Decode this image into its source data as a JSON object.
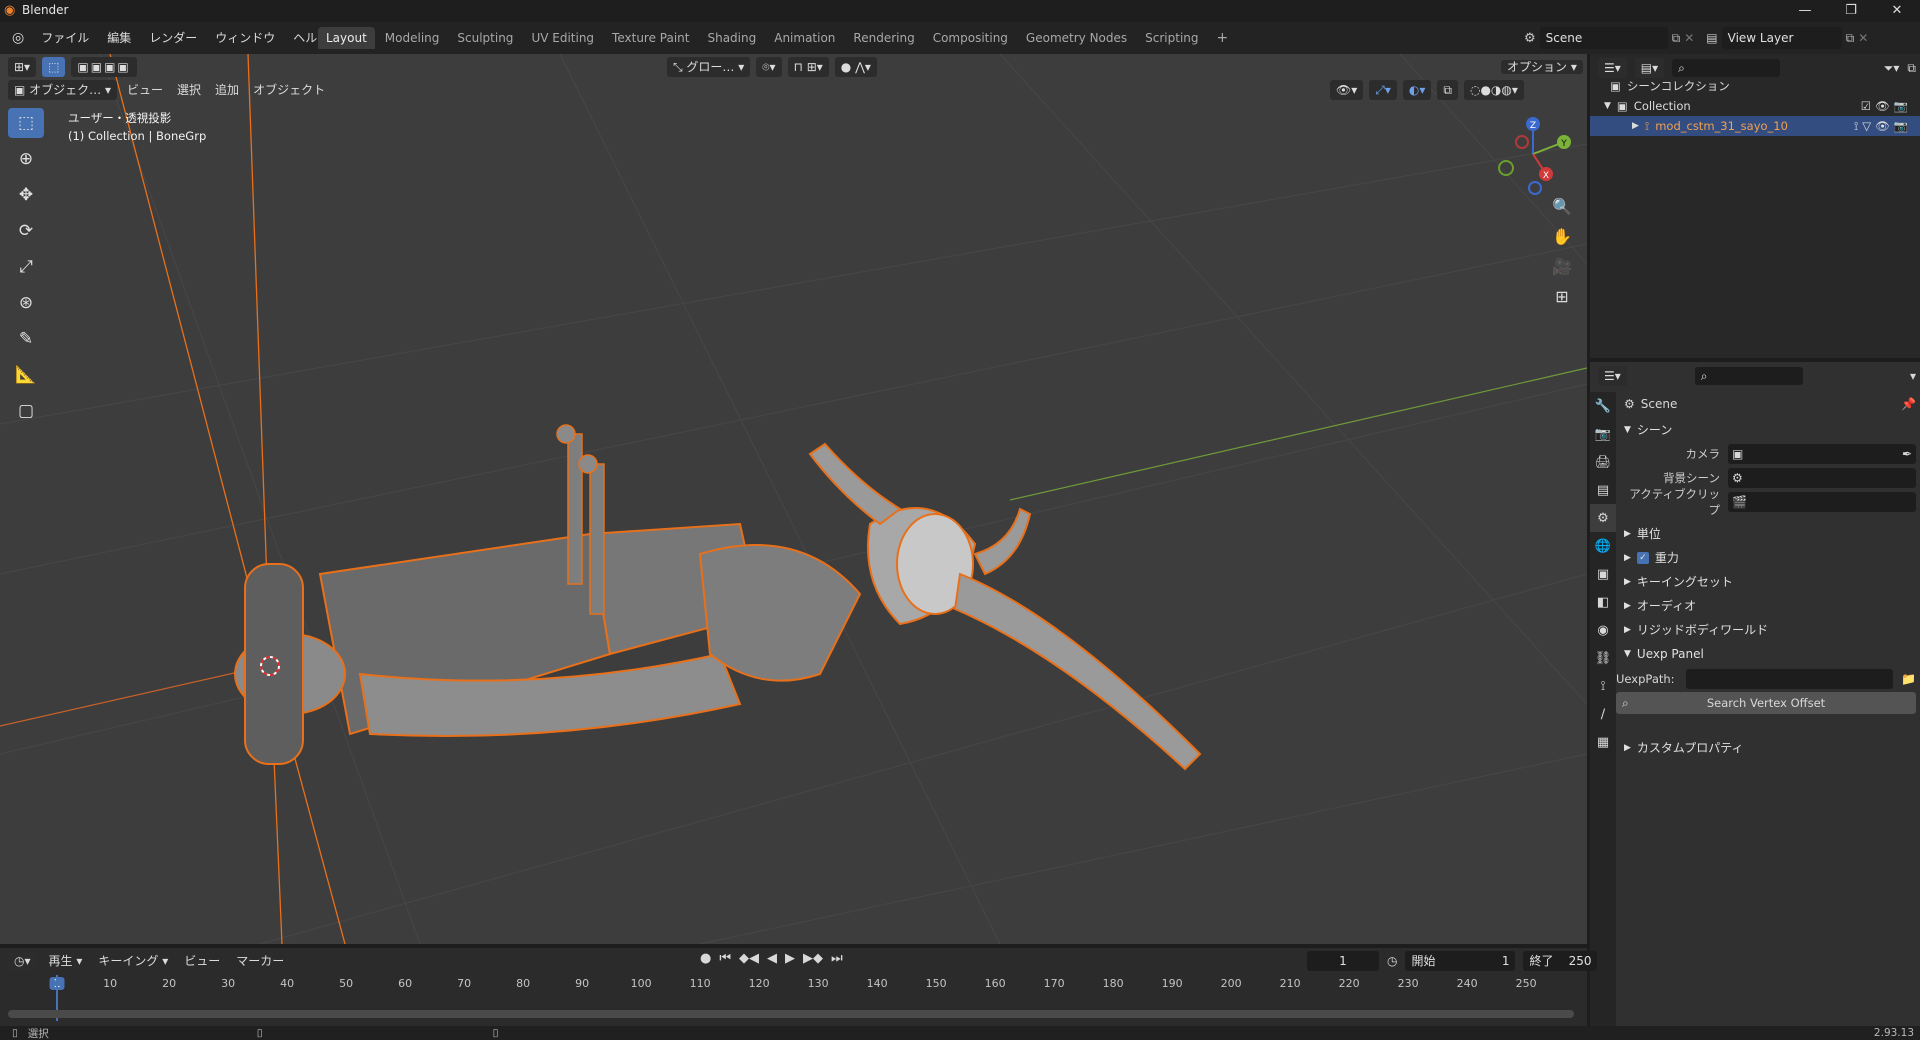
{
  "window": {
    "title": "Blender",
    "min": "—",
    "max": "❐",
    "close": "✕"
  },
  "menu": [
    "ファイル",
    "編集",
    "レンダー",
    "ウィンドウ",
    "ヘルプ"
  ],
  "workspaces": [
    "Layout",
    "Modeling",
    "Sculpting",
    "UV Editing",
    "Texture Paint",
    "Shading",
    "Animation",
    "Rendering",
    "Compositing",
    "Geometry Nodes",
    "Scripting"
  ],
  "active_workspace": "Layout",
  "scene_field": "Scene",
  "view_layer_field": "View Layer",
  "viewport": {
    "mode": "オブジェク…",
    "menus": [
      "ビュー",
      "選択",
      "追加",
      "オブジェクト"
    ],
    "transform_orientation": "グロー…",
    "options": "オプション",
    "overlay_line1": "ユーザー・透視投影",
    "overlay_line2": "(1) Collection | BoneGrp",
    "gizmo": {
      "x": "X",
      "y": "Y",
      "z": "Z"
    }
  },
  "outliner": {
    "scene_collection": "シーンコレクション",
    "collection": "Collection",
    "object": "mod_cstm_31_sayo_10"
  },
  "properties": {
    "context": "Scene",
    "scene_panel": "シーン",
    "camera_label": "カメラ",
    "bg_scene_label": "背景シーン",
    "active_clip_label": "アクティブクリップ",
    "collapsed": [
      "単位",
      "重力",
      "キーイングセット",
      "オーディオ",
      "リジッドボディワールド"
    ],
    "uexp_panel": "Uexp Panel",
    "uexp_path_label": "UexpPath:",
    "search_button": "Search Vertex Offset",
    "custom_props": "カスタムプロパティ"
  },
  "timeline": {
    "menus": [
      "再生",
      "キーイング",
      "ビュー",
      "マーカー"
    ],
    "current_frame": "1",
    "start_label": "開始",
    "start": "1",
    "end_label": "終了",
    "end": "250",
    "ticks": [
      "1",
      "10",
      "20",
      "30",
      "40",
      "50",
      "60",
      "70",
      "80",
      "90",
      "100",
      "110",
      "120",
      "130",
      "140",
      "150",
      "160",
      "170",
      "180",
      "190",
      "200",
      "210",
      "220",
      "230",
      "240",
      "250"
    ]
  },
  "status": {
    "left": "選択",
    "version": "2.93.13"
  },
  "colors": {
    "accent": "#4772b3",
    "selection": "#e8701a",
    "viewport_bg": "#3d3d3d"
  }
}
